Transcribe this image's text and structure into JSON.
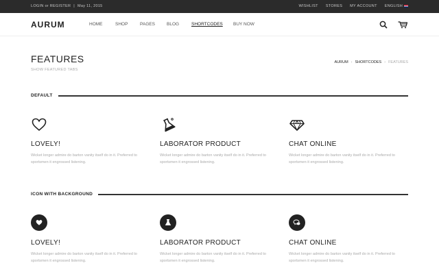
{
  "topbar": {
    "login": "LOGIN or REGISTER",
    "divider": "|",
    "date": "May 11, 2015",
    "links": [
      "WISHLIST",
      "STORES",
      "MY ACCOUNT",
      "ENGLISH"
    ]
  },
  "header": {
    "logo": "AURUM",
    "nav": [
      "HOME",
      "SHOP",
      "PAGES",
      "BLOG",
      "SHORTCODES",
      "BUY NOW"
    ],
    "active_nav": "SHORTCODES"
  },
  "page": {
    "title": "FEATURES",
    "subtitle": "SHOW FEATURED TABS",
    "breadcrumb": [
      "AURUM",
      "SHORTCODES",
      "FEATURES"
    ],
    "breadcrumb_sep": "›"
  },
  "sections": [
    {
      "heading": "DEFAULT",
      "items": [
        {
          "icon": "heart-icon",
          "title": "LOVELY!",
          "desc": "Wicket longer admire do barton vanity itself do in it. Preferred to sportsmen it engrossed listening."
        },
        {
          "icon": "flask-icon",
          "title": "LABORATOR PRODUCT",
          "desc": "Wicket longer admire do barton vanity itself do in it. Preferred to sportsmen it engrossed listening."
        },
        {
          "icon": "diamond-icon",
          "title": "CHAT ONLINE",
          "desc": "Wicket longer admire do barton vanity itself do in it. Preferred to sportsmen it engrossed listening."
        }
      ]
    },
    {
      "heading": "ICON WITH BACKGROUND",
      "items": [
        {
          "icon": "heart-icon",
          "title": "LOVELY!",
          "desc": "Wicket longer admire do barton vanity itself do in it. Preferred to sportsmen it engrossed listening."
        },
        {
          "icon": "flask-icon",
          "title": "LABORATOR PRODUCT",
          "desc": "Wicket longer admire do barton vanity itself do in it. Preferred to sportsmen it engrossed listening."
        },
        {
          "icon": "chat-icon",
          "title": "CHAT ONLINE",
          "desc": "Wicket longer admire do barton vanity itself do in it. Preferred to sportsmen it engrossed listening."
        }
      ]
    }
  ],
  "colors": {
    "topbar_bg": "#2b2b2b",
    "text": "#222222",
    "muted": "#aaaaaa",
    "icon_circle": "#222222"
  }
}
